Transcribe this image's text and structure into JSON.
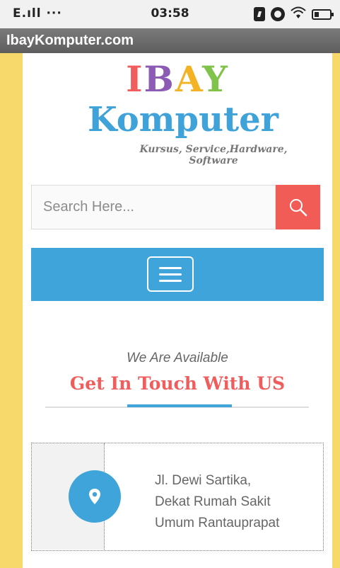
{
  "status_bar": {
    "signal_text": "E.ıll ···",
    "time": "03:58",
    "icons": [
      "data-saver-icon",
      "alarm-icon",
      "wifi-icon",
      "battery-icon"
    ]
  },
  "browser": {
    "title": "IbayKomputer.com"
  },
  "logo": {
    "line1_letters": [
      "I",
      "B",
      "A",
      "Y"
    ],
    "line1_colors": [
      "#ef5d5d",
      "#8c5bb4",
      "#f3b324",
      "#7fc34a"
    ],
    "line2": "Komputer",
    "tagline_line1": "Kursus, Service,Hardware,",
    "tagline_line2": "Software"
  },
  "search": {
    "placeholder": "Search Here...",
    "button_icon": "search-icon"
  },
  "nav": {
    "menu_icon": "hamburger-menu-icon"
  },
  "contact_section": {
    "subtitle": "We Are Available",
    "title": "Get In Touch With US"
  },
  "address_card": {
    "icon": "map-pin-icon",
    "lines": [
      "Jl. Dewi Sartika,",
      "Dekat Rumah Sakit",
      "Umum Rantauprapat"
    ]
  },
  "colors": {
    "frame_yellow": "#f6d96a",
    "accent_blue": "#3ea4d9",
    "accent_red": "#f25c56"
  }
}
